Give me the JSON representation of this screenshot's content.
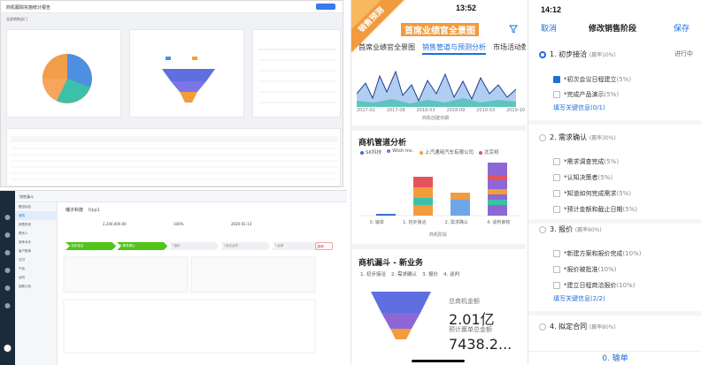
{
  "dashboard": {
    "title": "商机跟踪实施统计报告",
    "tab": "全部销售部门"
  },
  "crm": {
    "top_title": "销售漏斗",
    "company": "瑞子科技",
    "opp_code": "Opp1",
    "amount": "2,240,000.00",
    "percent": "100%",
    "date": "2020-01-13",
    "stages": [
      "1.初步接洽",
      "2.需求确认",
      "3.报价",
      "4.拟定合同",
      "5.赢单"
    ],
    "tag": "输单",
    "sidebar": [
      "跟进动态",
      "商机",
      "销售阶段",
      "联系人",
      "竞争对手",
      "客户账单",
      "交付",
      "产品",
      "合同",
      "回款计划"
    ]
  },
  "phone2": {
    "time": "13:52",
    "ribbon": "销售预测",
    "title": "首席业绩官全景图",
    "tabs": [
      "首席业绩官全景图",
      "销售管道与预测分析",
      "市场活动数"
    ],
    "x_ticks": [
      "2017-02",
      "2017-08",
      "2018-03",
      "2018-09",
      "2019-03",
      "2019-10"
    ],
    "axis_label": "商机创建日期",
    "pipeline_title": "商机管道分析",
    "legend": [
      {
        "name": "SK科技",
        "color": "#3b6fd6"
      },
      {
        "name": "Wish Inc.",
        "color": "#8e67d6"
      },
      {
        "name": "上汽通用汽车有限公司",
        "color": "#f39c3c"
      },
      {
        "name": "北京邦",
        "color": "#e3545f"
      }
    ],
    "pipeline_stages": [
      "0. 输单",
      "1. 初步接洽",
      "2. 需求确认",
      "4. 谈判审核"
    ],
    "pipeline_x_label": "商机阶段",
    "funnel_title": "商机漏斗 - 新业务",
    "funnel_steps": [
      "1. 初步接洽",
      "2. 需求确认",
      "3. 报价",
      "4. 谈判"
    ],
    "total_label": "总商机金额",
    "total_value": "2.01亿",
    "forecast_label": "预计赢单总金额",
    "forecast_value": "7438.2..."
  },
  "phone3": {
    "time": "14:12",
    "cancel": "取消",
    "title": "修改销售阶段",
    "save": "保存",
    "steps": [
      {
        "label": "1. 初步接洽",
        "ratio": "(赢率10%)",
        "status": "进行中",
        "tasks": [
          {
            "text": "*初次会议日程建立",
            "pct": "(5%)",
            "done": true
          },
          {
            "text": "*完成产品演示",
            "pct": "(5%)",
            "done": false
          }
        ],
        "link": "填写关键信息(0/1)"
      },
      {
        "label": "2. 需求确认",
        "ratio": "(赢率30%)",
        "tasks": [
          {
            "text": "*需求调查完成",
            "pct": "(5%)",
            "done": false
          },
          {
            "text": "*认知决策者",
            "pct": "(5%)",
            "done": false
          },
          {
            "text": "*知道如何完成需求",
            "pct": "(5%)",
            "done": false
          },
          {
            "text": "*预计金额和截止日期",
            "pct": "(5%)",
            "done": false
          }
        ]
      },
      {
        "label": "3. 报价",
        "ratio": "(赢率60%)",
        "tasks": [
          {
            "text": "*新建方案和报价完成",
            "pct": "(10%)",
            "done": false
          },
          {
            "text": "*报价被批准",
            "pct": "(10%)",
            "done": false
          },
          {
            "text": "*建立日程商洽报价",
            "pct": "(10%)",
            "done": false
          }
        ],
        "link": "填写关键信息(2/2)"
      },
      {
        "label": "4. 拟定合同",
        "ratio": "(赢率80%)",
        "tasks": []
      }
    ],
    "lose": "0. 输单"
  }
}
